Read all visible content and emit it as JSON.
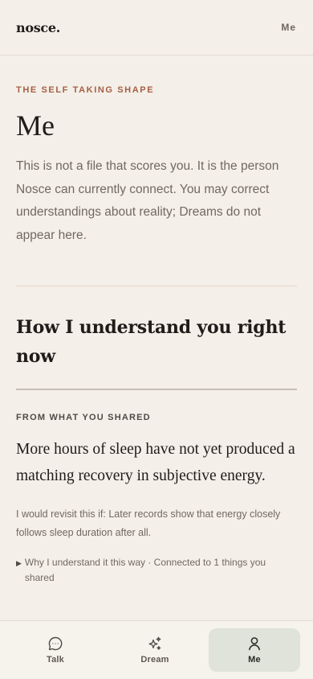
{
  "header": {
    "brand": "nosce.",
    "menu_link": "Me"
  },
  "main": {
    "eyebrow": "THE SELF TAKING SHAPE",
    "title": "Me",
    "intro": "This is not a file that scores you. It is the person Nosce can currently connect. You may correct understandings about reality; Dreams do not appear here.",
    "section_title": "How I understand you right now",
    "section_label": "FROM WHAT YOU SHARED",
    "statement": "More hours of sleep have not yet produced a matching recovery in subjective energy.",
    "revisit": "I would revisit this if: Later records show that energy closely follows sleep duration after all.",
    "why_marker": "▶",
    "why": "Why I understand it this way · Connected to 1 things you shared"
  },
  "nav": {
    "items": [
      {
        "label": "Talk",
        "icon": "chat-bubble-icon",
        "active": false
      },
      {
        "label": "Dream",
        "icon": "sparkles-icon",
        "active": false
      },
      {
        "label": "Me",
        "icon": "person-icon",
        "active": true
      }
    ]
  },
  "colors": {
    "background": "#f4efe8",
    "eyebrow": "#a55f45",
    "active_nav": "#dfe3da",
    "text_primary": "#1f1c19",
    "text_muted": "#6f6962"
  }
}
